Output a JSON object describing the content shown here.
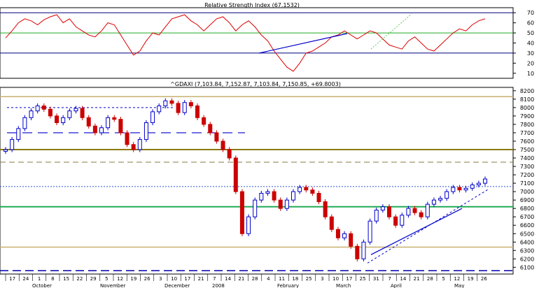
{
  "rsi": {
    "title": "Relative Strength Index (67.1532)",
    "ylim": [
      5,
      75
    ],
    "ticks": [
      10,
      20,
      30,
      40,
      50,
      60,
      70
    ],
    "levels_blue": [
      30,
      70
    ],
    "level_green": 50
  },
  "price": {
    "title": "^GDAXI (7,103.84, 7,152.87, 7,103.84, 7,150.85, +69.8003)",
    "ylim": [
      6020,
      8240
    ],
    "ticks": [
      6100,
      6200,
      6300,
      6400,
      6500,
      6600,
      6700,
      6800,
      6900,
      7000,
      7100,
      7200,
      7300,
      7400,
      7500,
      7600,
      7700,
      7800,
      7900,
      8000,
      8100,
      8200
    ],
    "khaki_levels": [
      8130,
      7500,
      6340
    ],
    "dashed_khaki": 7350,
    "green_level": 6820
  },
  "x_axis": {
    "day_labels": [
      "17",
      "24",
      "1",
      "8",
      "15",
      "22",
      "29",
      "5",
      "12",
      "19",
      "26",
      "3",
      "10",
      "17",
      "21",
      "7",
      "14",
      "21",
      "28",
      "4",
      "11",
      "18",
      "25",
      "3",
      "10",
      "17",
      "25",
      "31",
      "7",
      "14",
      "21",
      "28",
      "5",
      "12",
      "19",
      "26"
    ],
    "month_labels": [
      "October",
      "November",
      "December",
      "2008",
      "February",
      "March",
      "April",
      "May"
    ]
  },
  "chart_data": [
    {
      "type": "line",
      "title": "Relative Strength Index (67.1532)",
      "series": [
        {
          "x": [
            0,
            3,
            6,
            9,
            12,
            15,
            18,
            21,
            24,
            27,
            30,
            33,
            36,
            39,
            42,
            45,
            48,
            51,
            54,
            57,
            60,
            63,
            66,
            69,
            72,
            75,
            78,
            81,
            84,
            87,
            90,
            93,
            96,
            99,
            102,
            105,
            108,
            111,
            114,
            117,
            120,
            123,
            126,
            129,
            132,
            135,
            138,
            141,
            144,
            147,
            150,
            153,
            156,
            159,
            162,
            165,
            168,
            171,
            174,
            177,
            180,
            183,
            186,
            189,
            192,
            195,
            198,
            201,
            204,
            207,
            210,
            213,
            216,
            219,
            222,
            225
          ],
          "values": [
            45,
            52,
            60,
            64,
            62,
            58,
            63,
            66,
            68,
            60,
            64,
            56,
            52,
            48,
            46,
            52,
            60,
            58,
            48,
            38,
            28,
            32,
            42,
            50,
            48,
            56,
            64,
            66,
            68,
            62,
            58,
            52,
            58,
            64,
            66,
            60,
            52,
            58,
            62,
            56,
            48,
            42,
            32,
            24,
            16,
            12,
            20,
            30,
            32,
            36,
            40,
            46,
            48,
            52,
            48,
            44,
            48,
            52,
            50,
            44,
            38,
            36,
            34,
            42,
            46,
            40,
            34,
            32,
            38,
            44,
            50,
            54,
            52,
            58,
            62,
            64
          ]
        }
      ],
      "ylim": [
        5,
        75
      ]
    },
    {
      "type": "candlestick",
      "title": "^GDAXI (7,103.84, 7,152.87, 7,103.84, 7,150.85, +69.8003)",
      "ylim": [
        6020,
        8240
      ],
      "x": [
        0,
        3,
        6,
        9,
        12,
        15,
        18,
        21,
        24,
        27,
        30,
        33,
        36,
        39,
        42,
        45,
        48,
        51,
        54,
        57,
        60,
        63,
        66,
        69,
        72,
        75,
        78,
        81,
        84,
        87,
        90,
        93,
        96,
        99,
        102,
        105,
        108,
        111,
        114,
        117,
        120,
        123,
        126,
        129,
        132,
        135,
        138,
        141,
        144,
        147,
        150,
        153,
        156,
        159,
        162,
        165,
        168,
        171,
        174,
        177,
        180,
        183,
        186,
        189,
        192,
        195,
        198,
        201,
        204,
        207,
        210,
        213,
        216,
        219,
        222,
        225
      ],
      "close": [
        7500,
        7620,
        7750,
        7880,
        7960,
        8020,
        7980,
        7900,
        7820,
        7880,
        7960,
        7990,
        7880,
        7780,
        7700,
        7760,
        7880,
        7860,
        7700,
        7560,
        7500,
        7620,
        7820,
        7950,
        8020,
        8080,
        8050,
        7940,
        8060,
        8020,
        7880,
        7800,
        7700,
        7600,
        7500,
        7400,
        7000,
        6500,
        6700,
        6900,
        6980,
        7000,
        6900,
        6800,
        6900,
        7000,
        7050,
        7020,
        6980,
        6880,
        6700,
        6550,
        6450,
        6500,
        6350,
        6200,
        6400,
        6650,
        6780,
        6820,
        6700,
        6600,
        6720,
        6800,
        6750,
        6700,
        6850,
        6900,
        6920,
        7000,
        7050,
        7020,
        7040,
        7080,
        7100,
        7150
      ]
    }
  ]
}
